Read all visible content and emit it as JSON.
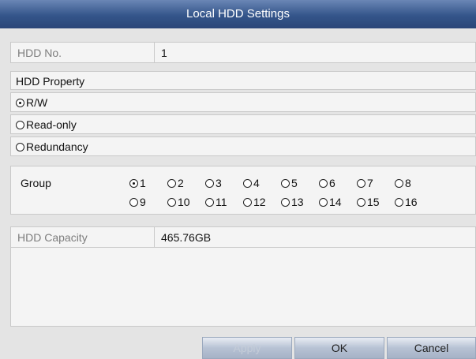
{
  "title": "Local HDD Settings",
  "hdd_no": {
    "label": "HDD No.",
    "value": "1"
  },
  "property": {
    "heading": "HDD Property",
    "options": [
      {
        "label": "R/W",
        "checked": true
      },
      {
        "label": "Read-only",
        "checked": false
      },
      {
        "label": "Redundancy",
        "checked": false
      }
    ]
  },
  "group": {
    "label": "Group",
    "options": [
      "1",
      "2",
      "3",
      "4",
      "5",
      "6",
      "7",
      "8",
      "9",
      "10",
      "11",
      "12",
      "13",
      "14",
      "15",
      "16"
    ],
    "selected": "1"
  },
  "capacity": {
    "label": "HDD Capacity",
    "value": "465.76GB"
  },
  "buttons": {
    "apply": "Apply",
    "ok": "OK",
    "cancel": "Cancel"
  }
}
